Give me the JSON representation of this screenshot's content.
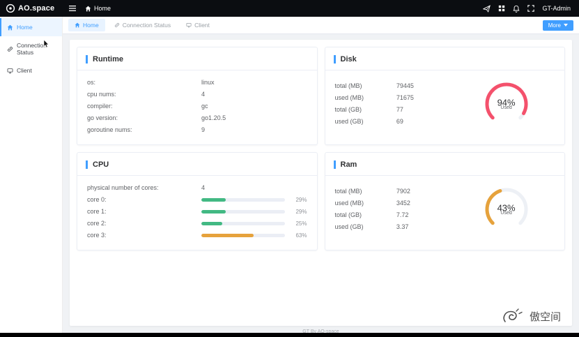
{
  "topbar": {
    "logo": "AO.space",
    "breadcrumb": "Home",
    "user": "GT-Admin"
  },
  "sidebar": {
    "items": [
      {
        "label": "Home"
      },
      {
        "label": "Connection Status"
      },
      {
        "label": "Client"
      }
    ]
  },
  "tabbar": {
    "tabs": [
      {
        "label": "Home"
      },
      {
        "label": "Connection Status"
      },
      {
        "label": "Client"
      }
    ],
    "more_label": "More"
  },
  "cards": {
    "runtime": {
      "title": "Runtime",
      "rows": [
        {
          "label": "os:",
          "value": "linux"
        },
        {
          "label": "cpu nums:",
          "value": "4"
        },
        {
          "label": "compiler:",
          "value": "gc"
        },
        {
          "label": "go version:",
          "value": "go1.20.5"
        },
        {
          "label": "goroutine nums:",
          "value": "9"
        }
      ]
    },
    "disk": {
      "title": "Disk",
      "rows": [
        {
          "label": "total (MB)",
          "value": "79445"
        },
        {
          "label": "used (MB)",
          "value": "71675"
        },
        {
          "label": "total (GB)",
          "value": "77"
        },
        {
          "label": "used (GB)",
          "value": "69"
        }
      ],
      "gauge": {
        "percent": 94,
        "label": "Used",
        "color": "#F4516C"
      }
    },
    "cpu": {
      "title": "CPU",
      "static_rows": [
        {
          "label": "physical number of cores:",
          "value": "4"
        }
      ],
      "bars": [
        {
          "label": "core 0:",
          "percent": 29,
          "color": "#42b983"
        },
        {
          "label": "core 1:",
          "percent": 29,
          "color": "#42b983"
        },
        {
          "label": "core 2:",
          "percent": 25,
          "color": "#42b983"
        },
        {
          "label": "core 3:",
          "percent": 63,
          "color": "#E6A23C"
        }
      ]
    },
    "ram": {
      "title": "Ram",
      "rows": [
        {
          "label": "total (MB)",
          "value": "7902"
        },
        {
          "label": "used (MB)",
          "value": "3452"
        },
        {
          "label": "total (GB)",
          "value": "7.72"
        },
        {
          "label": "used (GB)",
          "value": "3.37"
        }
      ],
      "gauge": {
        "percent": 43,
        "label": "Used",
        "color": "#E6A23C"
      }
    }
  },
  "footer": {
    "text": "GT By AO-space"
  },
  "watermark": {
    "text": "傲空间"
  },
  "colors": {
    "accent": "#409EFF",
    "green": "#42b983",
    "orange": "#E6A23C",
    "red": "#F4516C"
  }
}
